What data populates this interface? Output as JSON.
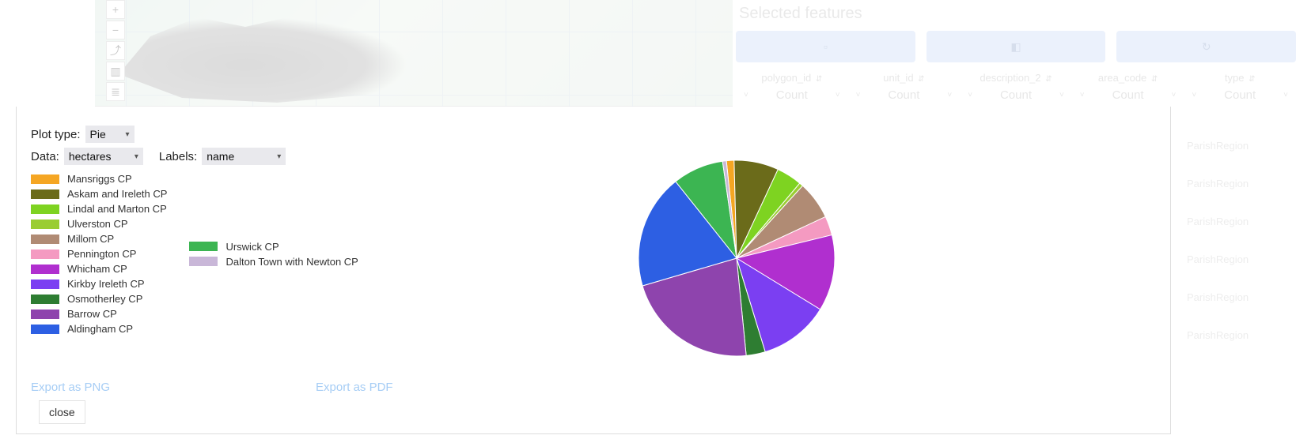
{
  "map_controls": [
    "+",
    "−",
    "⤴",
    "▥",
    "≣"
  ],
  "right_panel": {
    "title": "Selected features",
    "buttons": [
      "▫",
      "◧",
      "↻"
    ],
    "columns": [
      "polygon_id",
      "unit_id",
      "description_2",
      "area_code",
      "type"
    ],
    "agg_label": "Count",
    "repeat_text": "ParishRegion"
  },
  "controls": {
    "plot_type_label": "Plot type:",
    "plot_type_value": "Pie",
    "data_label": "Data:",
    "data_value": "hectares",
    "labels_label": "Labels:",
    "labels_value": "name"
  },
  "actions": {
    "export_png": "Export as PNG",
    "export_pdf": "Export as PDF",
    "close": "close"
  },
  "chart_data": {
    "type": "pie",
    "title": "",
    "series": [
      {
        "name": "Mansriggs CP",
        "value": 1.2,
        "color": "#f5a623"
      },
      {
        "name": "Askam and Ireleth CP",
        "value": 7.0,
        "color": "#6b6b1a"
      },
      {
        "name": "Lindal and Marton CP",
        "value": 4.0,
        "color": "#7ed321"
      },
      {
        "name": "Ulverston CP",
        "value": 0.6,
        "color": "#9acd32"
      },
      {
        "name": "Millom CP",
        "value": 6.0,
        "color": "#b08b74"
      },
      {
        "name": "Pennington CP",
        "value": 3.0,
        "color": "#f49ac1"
      },
      {
        "name": "Whicham CP",
        "value": 12.0,
        "color": "#b02fcf"
      },
      {
        "name": "Kirkby Ireleth CP",
        "value": 11.0,
        "color": "#7b3ff2"
      },
      {
        "name": "Osmotherley CP",
        "value": 3.0,
        "color": "#2e7d32"
      },
      {
        "name": "Barrow CP",
        "value": 21.0,
        "color": "#8e44ad"
      },
      {
        "name": "Aldingham CP",
        "value": 18.0,
        "color": "#2d5fe3"
      },
      {
        "name": "Urswick CP",
        "value": 8.0,
        "color": "#3cb552"
      },
      {
        "name": "Dalton Town with Newton CP",
        "value": 0.6,
        "color": "#c9b7d8"
      }
    ],
    "legend_columns": [
      [
        "Mansriggs CP",
        "Askam and Ireleth CP",
        "Lindal and Marton CP",
        "Ulverston CP",
        "Millom CP",
        "Pennington CP",
        "Whicham CP",
        "Kirkby Ireleth CP",
        "Osmotherley CP",
        "Barrow CP",
        "Aldingham CP"
      ],
      [
        "Urswick CP",
        "Dalton Town with Newton CP"
      ]
    ],
    "start_angle_deg": -6
  }
}
